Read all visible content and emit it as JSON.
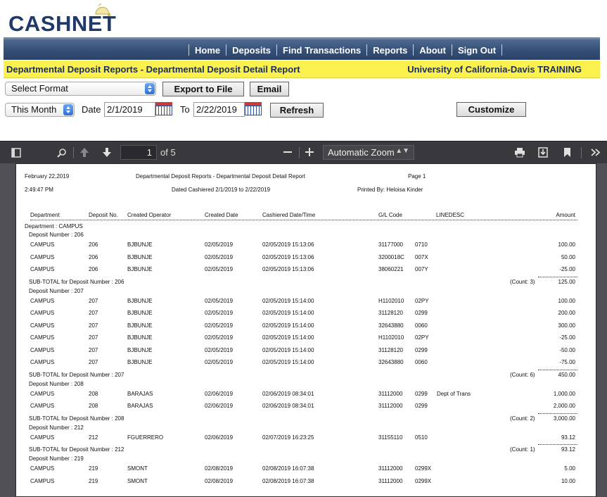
{
  "logo": {
    "text": "CASHNET"
  },
  "nav": {
    "items": [
      "Home",
      "Deposits",
      "Find Transactions",
      "Reports",
      "About",
      "Sign Out"
    ]
  },
  "titlebar": {
    "left": "Departmental Deposit Reports - Departmental Deposit Detail Report",
    "right": "University of California-Davis TRAINING"
  },
  "controls": {
    "format_select": "Select Format",
    "export_button": "Export to File",
    "email_button": "Email",
    "period_select": "This Month",
    "date_label": "Date",
    "date_from": "2/1/2019",
    "to_label": "To",
    "date_to": "2/22/2019",
    "refresh_button": "Refresh",
    "customize_button": "Customize"
  },
  "pdf": {
    "page_current": "1",
    "page_total": "of 5",
    "zoom": "Automatic Zoom"
  },
  "report": {
    "date": "February 22,2019",
    "time": "2:49:47 PM",
    "title": "Departmental Deposit Reports - Departmental Deposit Detail Report",
    "dated": "Dated Cashiered 2/1/2019 to 2/22/2019",
    "page": "Page 1",
    "printed_by": "Printed By: Heloisa Kinder",
    "columns": [
      "Department",
      "Deposit No.",
      "Created Operator",
      "Created Date",
      "Cashiered Date/Time",
      "G/L Code",
      "LINEDESC",
      "Amount"
    ],
    "department_line": "Department : CAMPUS",
    "groups": [
      {
        "heading": "Deposit Number : 206",
        "rows": [
          [
            "CAMPUS",
            "206",
            "BJBUNJE",
            "02/05/2019",
            "02/05/2019 15:13:06",
            "31177000",
            "0710",
            "",
            "100.00"
          ],
          [
            "CAMPUS",
            "206",
            "BJBUNJE",
            "02/05/2019",
            "02/05/2019 15:13:06",
            "3200018C",
            "007X",
            "",
            "50.00"
          ],
          [
            "CAMPUS",
            "206",
            "BJBUNJE",
            "02/05/2019",
            "02/05/2019 15:13:06",
            "38060221",
            "007Y",
            "",
            "-25.00"
          ]
        ],
        "subtotal_label": "SUB-TOTAL for Deposit Number : 206",
        "count": "(Count: 3)",
        "total": "125.00"
      },
      {
        "heading": "Deposit Number : 207",
        "rows": [
          [
            "CAMPUS",
            "207",
            "BJBUNJE",
            "02/05/2019",
            "02/05/2019 15:14:00",
            "H1102010",
            "02PY",
            "",
            "100.00"
          ],
          [
            "CAMPUS",
            "207",
            "BJBUNJE",
            "02/05/2019",
            "02/05/2019 15:14:00",
            "31128120",
            "0299",
            "",
            "200.00"
          ],
          [
            "CAMPUS",
            "207",
            "BJBUNJE",
            "02/05/2019",
            "02/05/2019 15:14:00",
            "32643880",
            "0060",
            "",
            "300.00"
          ],
          [
            "CAMPUS",
            "207",
            "BJBUNJE",
            "02/05/2019",
            "02/05/2019 15:14:00",
            "H1102010",
            "02PY",
            "",
            "-25.00"
          ],
          [
            "CAMPUS",
            "207",
            "BJBUNJE",
            "02/05/2019",
            "02/05/2019 15:14:00",
            "31128120",
            "0299",
            "",
            "-50.00"
          ],
          [
            "CAMPUS",
            "207",
            "BJBUNJE",
            "02/05/2019",
            "02/05/2019 15:14:00",
            "32643880",
            "0060",
            "",
            "-75.00"
          ]
        ],
        "subtotal_label": "SUB-TOTAL for Deposit Number : 207",
        "count": "(Count: 6)",
        "total": "450.00"
      },
      {
        "heading": "Deposit Number : 208",
        "rows": [
          [
            "CAMPUS",
            "208",
            "BARAJAS",
            "02/06/2019",
            "02/06/2019 08:34:01",
            "31112000",
            "0299",
            "Dept of Trans",
            "1,000.00"
          ],
          [
            "CAMPUS",
            "208",
            "BARAJAS",
            "02/06/2019",
            "02/06/2019 08:34:01",
            "31112000",
            "0299",
            "",
            "2,000.00"
          ]
        ],
        "subtotal_label": "SUB-TOTAL for Deposit Number : 208",
        "count": "(Count: 2)",
        "total": "3,000.00"
      },
      {
        "heading": "Deposit Number : 212",
        "rows": [
          [
            "CAMPUS",
            "212",
            "FGUERRERO",
            "02/06/2019",
            "02/07/2019 16:23:25",
            "31155110",
            "0510",
            "",
            "93.12"
          ]
        ],
        "subtotal_label": "SUB-TOTAL for Deposit Number : 212",
        "count": "(Count: 1)",
        "total": "93.12"
      },
      {
        "heading": "Deposit Number : 219",
        "rows": [
          [
            "CAMPUS",
            "219",
            "SMONT",
            "02/08/2019",
            "02/08/2019 16:07:38",
            "31112000",
            "0299X",
            "",
            "5.00"
          ],
          [
            "CAMPUS",
            "219",
            "SMONT",
            "02/08/2019",
            "02/08/2019 16:07:38",
            "31112000",
            "0299X",
            "",
            "10.00"
          ]
        ]
      }
    ]
  }
}
